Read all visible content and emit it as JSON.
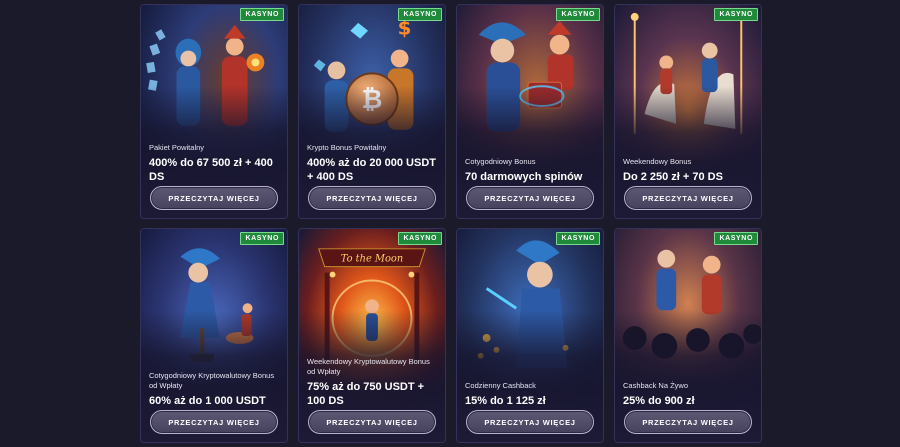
{
  "cards": [
    {
      "badge": "KASYNO",
      "subtitle": "Pakiet Powitalny",
      "offer": "400% do 67 500 zł + 400 DS",
      "button": "PRZECZYTAJ WIĘCEJ"
    },
    {
      "badge": "KASYNO",
      "subtitle": "Krypto Bonus Powitalny",
      "offer": "400% aż do 20 000 USDT + 400 DS",
      "button": "PRZECZYTAJ WIĘCEJ"
    },
    {
      "badge": "KASYNO",
      "subtitle": "Cotygodniowy Bonus",
      "offer": "70 darmowych spinów",
      "button": "PRZECZYTAJ WIĘCEJ"
    },
    {
      "badge": "KASYNO",
      "subtitle": "Weekendowy Bonus",
      "offer": "Do 2 250 zł + 70 DS",
      "button": "PRZECZYTAJ WIĘCEJ"
    },
    {
      "badge": "KASYNO",
      "subtitle": "Cotygodniowy Kryptowalutowy Bonus od Wpłaty",
      "offer": "60% aż do 1 000 USDT",
      "button": "PRZECZYTAJ WIĘCEJ"
    },
    {
      "badge": "KASYNO",
      "subtitle": "Weekendowy Kryptowalutowy Bonus od Wpłaty",
      "offer": "75% aż do 750 USDT + 100 DS",
      "button": "PRZECZYTAJ WIĘCEJ"
    },
    {
      "badge": "KASYNO",
      "subtitle": "Codzienny Cashback",
      "offer": "15% do 1 125 zł",
      "button": "PRZECZYTAJ WIĘCEJ"
    },
    {
      "badge": "KASYNO",
      "subtitle": "Cashback Na Żywo",
      "offer": "25% do 900 zł",
      "button": "PRZECZYTAJ WIĘCEJ"
    }
  ],
  "art_labels": {
    "moon_sign": "To the Moon"
  },
  "colors": {
    "badge": "#1f8a3a",
    "page_bg": "#1b1a2b",
    "card_border": "#34325a"
  }
}
